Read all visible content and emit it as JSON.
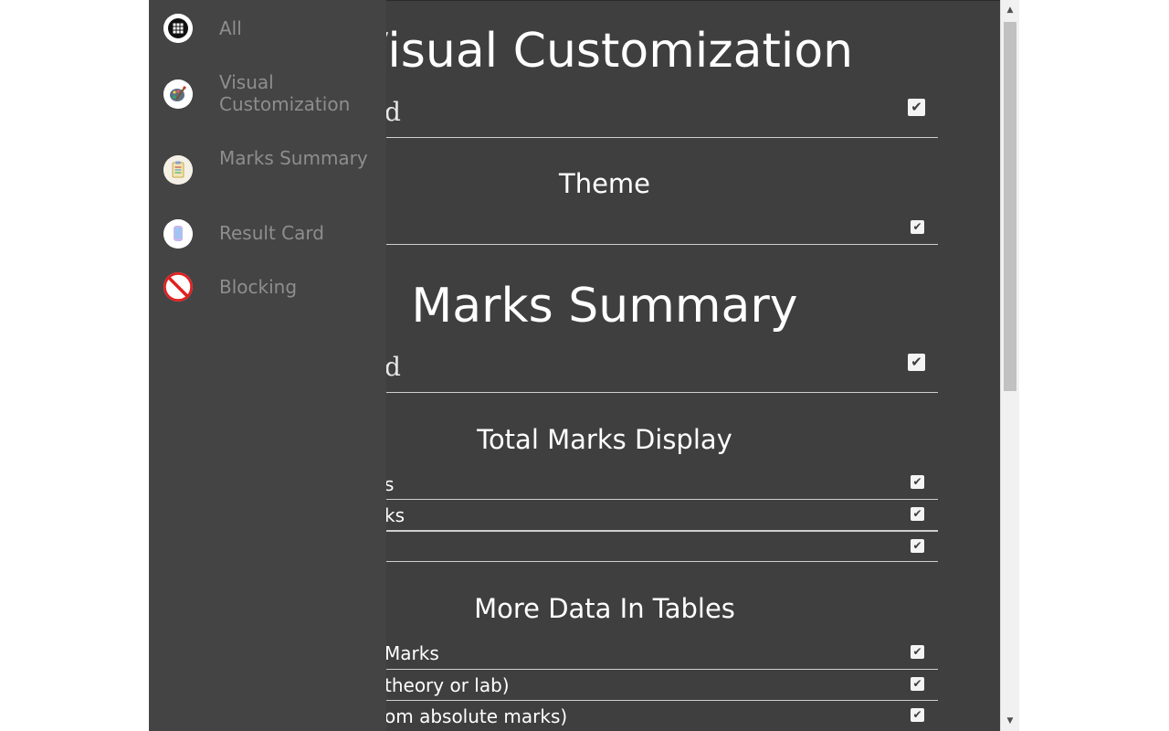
{
  "sidebar": {
    "items": [
      {
        "label": "All",
        "icon": "grid-icon"
      },
      {
        "label": "Visual Customization",
        "icon": "palette-icon"
      },
      {
        "label": "Marks Summary",
        "icon": "clipboard-icon"
      },
      {
        "label": "Result Card",
        "icon": "card-icon"
      },
      {
        "label": "Blocking",
        "icon": "block-icon"
      }
    ]
  },
  "main": {
    "visual": {
      "title": "Visual Customization",
      "enabled_label_fragment": "d",
      "theme_heading": "Theme"
    },
    "marks": {
      "title": "Marks Summary",
      "enabled_label_fragment": "d",
      "total_heading": "Total Marks Display",
      "total_rows": [
        "s",
        "ks",
        ""
      ],
      "tables_heading": "More Data In Tables",
      "tables_rows": [
        "Marks",
        " theory or lab)",
        "om absolute marks)"
      ]
    }
  },
  "colors": {
    "panel_bg": "#3f3f3f",
    "sidebar_bg": "#444444",
    "sidebar_label": "#8e8e8e",
    "text": "#ffffff",
    "divider": "#cfcfcf",
    "block_red": "#e02020"
  },
  "scrollbar": {
    "up_glyph": "▲",
    "down_glyph": "▼"
  }
}
